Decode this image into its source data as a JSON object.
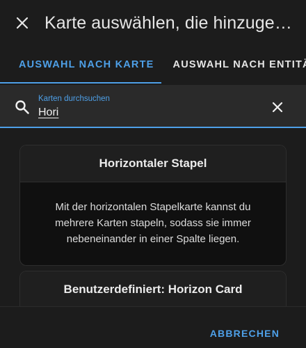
{
  "header": {
    "title": "Karte auswählen, die hinzugefügt werden soll",
    "close_icon": "close-icon"
  },
  "tabs": [
    {
      "label": "AUSWAHL NACH KARTE",
      "active": true
    },
    {
      "label": "AUSWAHL NACH ENTITÄT",
      "active": false
    }
  ],
  "search": {
    "label": "Karten durchsuchen",
    "value": "Hori",
    "icon": "search-icon",
    "clear_icon": "clear-icon"
  },
  "cards": [
    {
      "title": "Horizontaler Stapel",
      "description": "Mit der horizontalen Stapelkarte kannst du mehrere Karten stapeln, sodass sie immer nebeneinander in einer Spalte liegen."
    },
    {
      "title": "Benutzerdefiniert: Horizon Card",
      "description": ""
    }
  ],
  "footer": {
    "cancel_label": "ABBRECHEN"
  },
  "colors": {
    "accent": "#4ea0e8",
    "background": "#1c1c1c",
    "card": "#101010"
  }
}
